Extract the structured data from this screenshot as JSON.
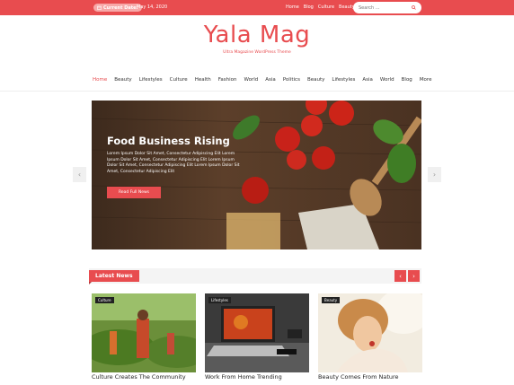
{
  "topbar": {
    "date_label": "Current Date:",
    "date_value": "May 14, 2020",
    "links": [
      "Home",
      "Blog",
      "Culture",
      "Beauty"
    ],
    "search_placeholder": "Search ..."
  },
  "site": {
    "title": "Yala Mag",
    "tagline": "Ultra Magazine WordPress Theme"
  },
  "nav": {
    "items": [
      "Home",
      "Beauty",
      "Lifestyles",
      "Culture",
      "Health",
      "Fashion",
      "World",
      "Asia",
      "Politics",
      "Beauty",
      "Lifestyles",
      "Asia",
      "World",
      "Blog",
      "More"
    ],
    "active_index": 0
  },
  "hero": {
    "title": "Food Business Rising",
    "text": "Lorem Ipsum Dolor Sit Amet, Consectetur Adipiscing Elit Lorem Ipsum Dolor Sit Amet, Consectetur Adipiscing Elit Lorem Ipsum Dolor Sit Amet, Consectetur Adipiscing Elit Lorem Ipsum Dolor Sit Amet, Consectetur Adipiscing Elit",
    "button": "Read Full News",
    "prev": "‹",
    "next": "›"
  },
  "latest": {
    "label": "Latest News",
    "prev": "‹",
    "next": "›"
  },
  "cards": [
    {
      "category": "Culture",
      "title": "Culture Creates The Community"
    },
    {
      "category": "Lifestyles",
      "title": "Work From Home Trending"
    },
    {
      "category": "Beauty",
      "title": "Beauty Comes From Nature"
    }
  ],
  "colors": {
    "accent": "#e84c4f"
  }
}
